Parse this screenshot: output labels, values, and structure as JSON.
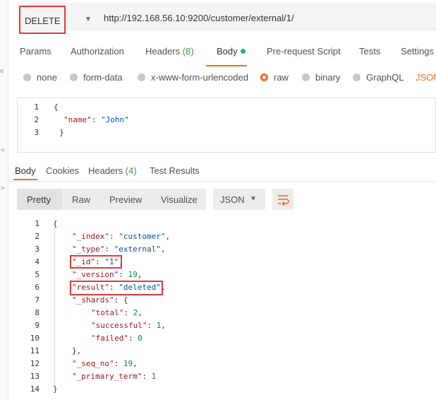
{
  "left_marks": [
    "e",
    "<",
    ">"
  ],
  "request": {
    "method": "DELETE",
    "url": "http://192.168.56.10:9200/customer/external/1/"
  },
  "req_tabs": {
    "params": "Params",
    "authorization": "Authorization",
    "headers": "Headers",
    "headers_count": "(8)",
    "body": "Body",
    "prerequest": "Pre-request Script",
    "tests": "Tests",
    "settings": "Settings"
  },
  "body_types": {
    "none": "none",
    "form_data": "form-data",
    "urlencoded": "x-www-form-urlencoded",
    "raw": "raw",
    "binary": "binary",
    "graphql": "GraphQL",
    "json": "JSON",
    "selected": "raw"
  },
  "request_body": {
    "line_numbers": [
      "1",
      "2",
      "3"
    ],
    "open": "{",
    "name_key": "\"name\"",
    "name_value": "\"John\"",
    "close": "}"
  },
  "resp_tabs": {
    "body": "Body",
    "cookies": "Cookies",
    "headers": "Headers",
    "headers_count": "(4)",
    "test_results": "Test Results"
  },
  "view": {
    "pretty": "Pretty",
    "raw": "Raw",
    "preview": "Preview",
    "visualize": "Visualize",
    "format": "JSON",
    "wrap_icon": "wrap-lines-icon"
  },
  "response_body": {
    "line_numbers": [
      "1",
      "2",
      "3",
      "4",
      "5",
      "6",
      "7",
      "8",
      "9",
      "10",
      "11",
      "12",
      "13",
      "14"
    ],
    "open": "{",
    "index_key": "\"_index\"",
    "index_value": "\"customer\"",
    "type_key": "\"_type\"",
    "type_value": "\"external\"",
    "id_key": "\"_id\"",
    "id_value": "\"1\"",
    "version_key": "\"_version\"",
    "version_value": "19",
    "result_key": "\"result\"",
    "result_value": "\"deleted\"",
    "shards_key": "\"_shards\"",
    "shards_open": "{",
    "total_key": "\"total\"",
    "total_value": "2",
    "successful_key": "\"successful\"",
    "successful_value": "1",
    "failed_key": "\"failed\"",
    "failed_value": "0",
    "shards_close": "},",
    "seq_key": "\"_seq_no\"",
    "seq_value": "19",
    "term_key": "\"_primary_term\"",
    "term_value": "1",
    "close": "}"
  },
  "colors": {
    "accent": "#ef6c1f",
    "highlight_box": "#e03a3a",
    "json_key": "#a31515",
    "json_string": "#0451a5",
    "json_number": "#098658"
  }
}
